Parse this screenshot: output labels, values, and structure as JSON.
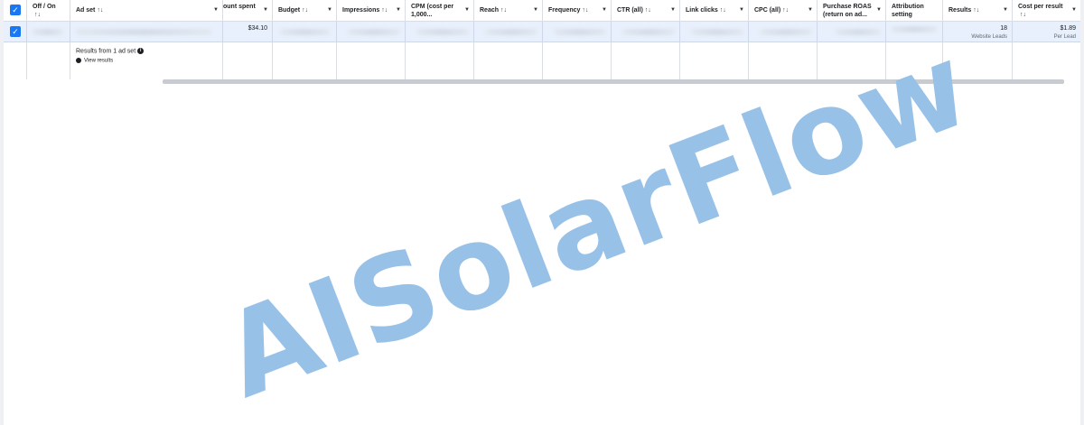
{
  "columns": [
    {
      "label": "",
      "sort": "",
      "caret": false
    },
    {
      "label": "Off / On",
      "sort": "↑↓",
      "caret": false
    },
    {
      "label": "Ad set",
      "sort": "↑↓",
      "caret": true
    },
    {
      "label": "ount spent",
      "sort": "",
      "caret": true
    },
    {
      "label": "Budget",
      "sort": "↑↓",
      "caret": true
    },
    {
      "label": "Impressions",
      "sort": "↑↓",
      "caret": true
    },
    {
      "label": "CPM (cost per 1,000...",
      "sort": "",
      "caret": true
    },
    {
      "label": "Reach",
      "sort": "↑↓",
      "caret": true
    },
    {
      "label": "Frequency",
      "sort": "↑↓",
      "caret": true
    },
    {
      "label": "CTR (all)",
      "sort": "↑↓",
      "caret": true
    },
    {
      "label": "Link clicks",
      "sort": "↑↓",
      "caret": true
    },
    {
      "label": "CPC (all)",
      "sort": "↑↓",
      "caret": true
    },
    {
      "label": "Purchase ROAS (return on ad...",
      "sort": "",
      "caret": true
    },
    {
      "label": "Attribution setting",
      "sort": "",
      "caret": false
    },
    {
      "label": "Results",
      "sort": "↑↓",
      "caret": true
    },
    {
      "label": "Cost per result",
      "sort": "↑↓",
      "caret": true
    }
  ],
  "data_row": {
    "amount_spent": "$34.10",
    "results": "18",
    "results_sub": "Website Leads",
    "cost_per_result": "$1.89",
    "cost_per_result_sub": "Per Lead"
  },
  "summary": {
    "title": "Results from 1 ad set",
    "info_glyph": "i",
    "view_results": "View results"
  },
  "checkbox_glyph": "✓",
  "watermark": "AISolarFlow",
  "colors": {
    "accent": "#1877f2",
    "watermark": "#98c1e8",
    "selected_row": "#e7f0fc"
  }
}
